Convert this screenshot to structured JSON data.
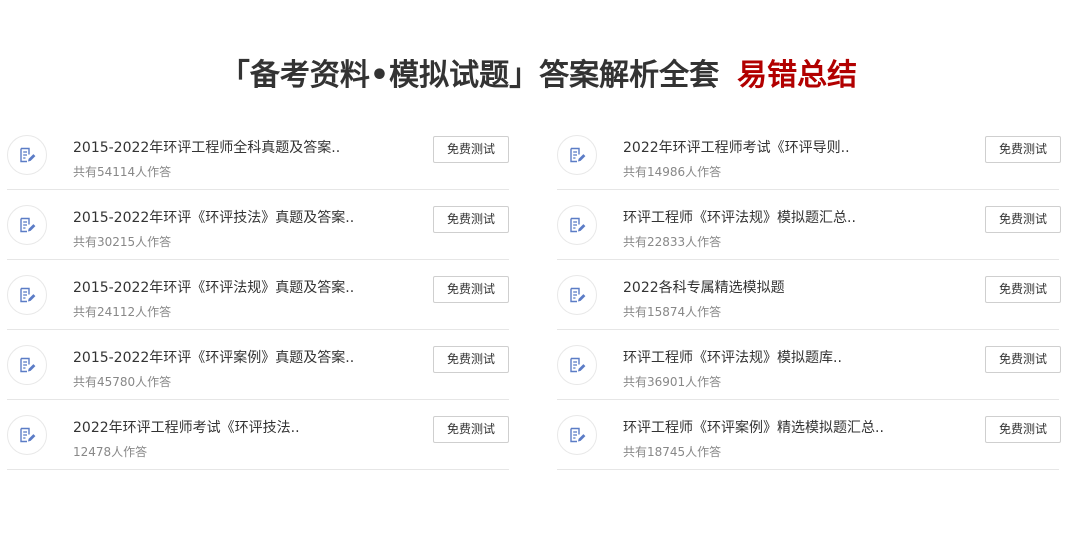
{
  "header": {
    "title_main": "「备考资料•模拟试题」答案解析全套",
    "title_accent": "易错总结"
  },
  "icons": {
    "item_icon": "doc-edit-icon",
    "icon_color": "#5b7cc6"
  },
  "left_list": [
    {
      "name": "2015-2022年环评工程师全科真题及答案..",
      "count": "共有54114人作答",
      "button": "免费测试"
    },
    {
      "name": "2015-2022年环评《环评技法》真题及答案..",
      "count": "共有30215人作答",
      "button": "免费测试"
    },
    {
      "name": "2015-2022年环评《环评法规》真题及答案..",
      "count": "共有24112人作答",
      "button": "免费测试"
    },
    {
      "name": "2015-2022年环评《环评案例》真题及答案..",
      "count": "共有45780人作答",
      "button": "免费测试"
    },
    {
      "name": "2022年环评工程师考试《环评技法..",
      "count": "12478人作答",
      "button": "免费测试"
    }
  ],
  "right_list": [
    {
      "name": "2022年环评工程师考试《环评导则..",
      "count": "共有14986人作答",
      "button": "免费测试"
    },
    {
      "name": "环评工程师《环评法规》模拟题汇总..",
      "count": "共有22833人作答",
      "button": "免费测试"
    },
    {
      "name": "2022各科专属精选模拟题",
      "count": "共有15874人作答",
      "button": "免费测试"
    },
    {
      "name": "环评工程师《环评法规》模拟题库..",
      "count": "共有36901人作答",
      "button": "免费测试"
    },
    {
      "name": "环评工程师《环评案例》精选模拟题汇总..",
      "count": "共有18745人作答",
      "button": "免费测试"
    }
  ]
}
